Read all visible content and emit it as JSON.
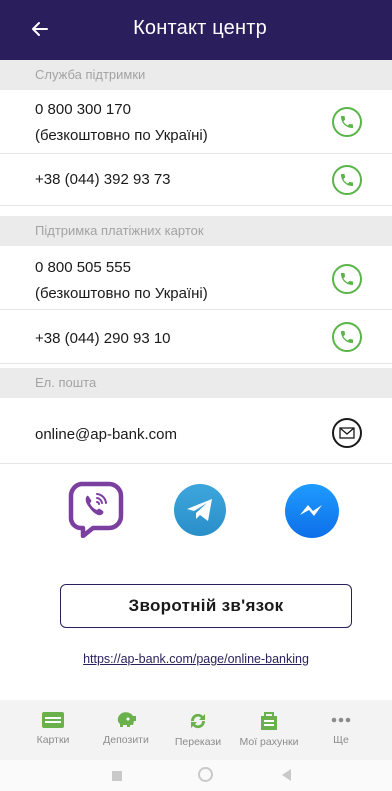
{
  "header": {
    "title": "Контакт центр"
  },
  "sections": [
    {
      "title": "Служба підтримки",
      "rows": [
        {
          "line1": "0 800 300 170",
          "line2": "(безкоштовно по Україні)",
          "icon": "phone-icon"
        },
        {
          "line1": "+38 (044) 392 93 73",
          "icon": "phone-icon"
        }
      ]
    },
    {
      "title": "Підтримка платіжних карток",
      "rows": [
        {
          "line1": "0 800 505 555",
          "line2": "(безкоштовно по Україні)",
          "icon": "phone-icon"
        },
        {
          "line1": "+38 (044) 290 93 10",
          "icon": "phone-icon"
        }
      ]
    },
    {
      "title": "Ел. пошта",
      "rows": [
        {
          "line1": "online@ap-bank.com",
          "icon": "mail-icon"
        }
      ]
    }
  ],
  "messengers": [
    "viber-icon",
    "telegram-icon",
    "messenger-icon"
  ],
  "feedback_button": "Зворотній зв'язок",
  "link": "https://ap-bank.com/page/online-banking",
  "tabbar": [
    {
      "label": "Картки",
      "icon": "card-icon"
    },
    {
      "label": "Депозити",
      "icon": "piggy-bank-icon"
    },
    {
      "label": "Перекази",
      "icon": "transfer-icon"
    },
    {
      "label": "Мої рахунки",
      "icon": "wallet-icon"
    },
    {
      "label": "Ще",
      "icon": "more-icon"
    }
  ],
  "colors": {
    "header": "#2a1f5c",
    "accent_green": "#59b547",
    "viber": "#7b3fa0",
    "telegram": "#2f9bd6",
    "messenger": "#1479f0"
  }
}
